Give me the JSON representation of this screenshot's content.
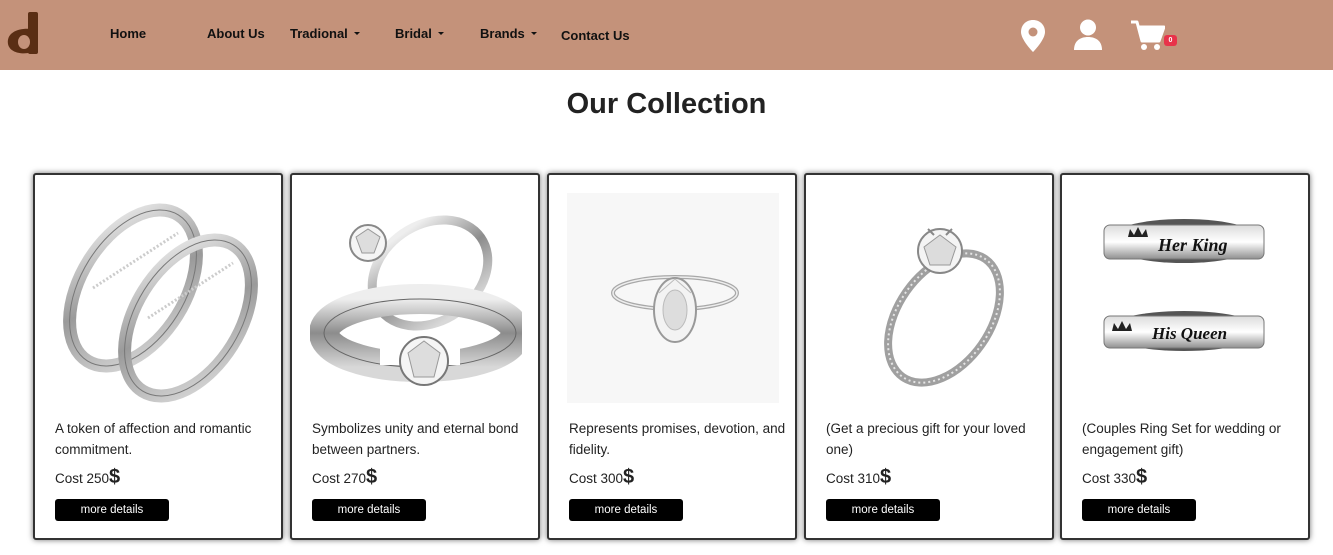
{
  "nav": {
    "items": [
      {
        "label": "Home",
        "dropdown": false
      },
      {
        "label": "About Us",
        "dropdown": false
      },
      {
        "label": "Tradional",
        "dropdown": true
      },
      {
        "label": "Bridal",
        "dropdown": true
      },
      {
        "label": "Brands",
        "dropdown": true
      },
      {
        "label": "Contact Us",
        "dropdown": false
      }
    ],
    "cart_count": "0",
    "icons": [
      "logo-icon",
      "location-pin-icon",
      "user-icon",
      "cart-icon"
    ],
    "bar_color": "#c4927a",
    "badge_color": "#e8334a"
  },
  "page_title": "Our Collection",
  "products": [
    {
      "image": "couple-wave-rings-icon",
      "description": "A token of affection and romantic commitment.",
      "cost_label": "Cost 250",
      "currency": "$",
      "button": "more details"
    },
    {
      "image": "engagement-and-band-rings-icon",
      "description": "Symbolizes unity and eternal bond between partners.",
      "cost_label": "Cost 270",
      "currency": "$",
      "button": "more details"
    },
    {
      "image": "oval-diamond-ring-icon",
      "description": "Represents promises, devotion, and fidelity.",
      "cost_label": "Cost 300",
      "currency": "$",
      "button": "more details"
    },
    {
      "image": "solitaire-pave-ring-icon",
      "description": "(Get a precious gift for your loved one)",
      "cost_label": "Cost 310",
      "currency": "$",
      "button": "more details"
    },
    {
      "image": "her-king-his-queen-rings-icon",
      "description": "(Couples Ring Set for wedding or engagement gift)",
      "cost_label": "Cost 330",
      "currency": "$",
      "button": "more details"
    }
  ],
  "ring_engravings": {
    "top": "Her King",
    "bottom": "His Queen"
  }
}
